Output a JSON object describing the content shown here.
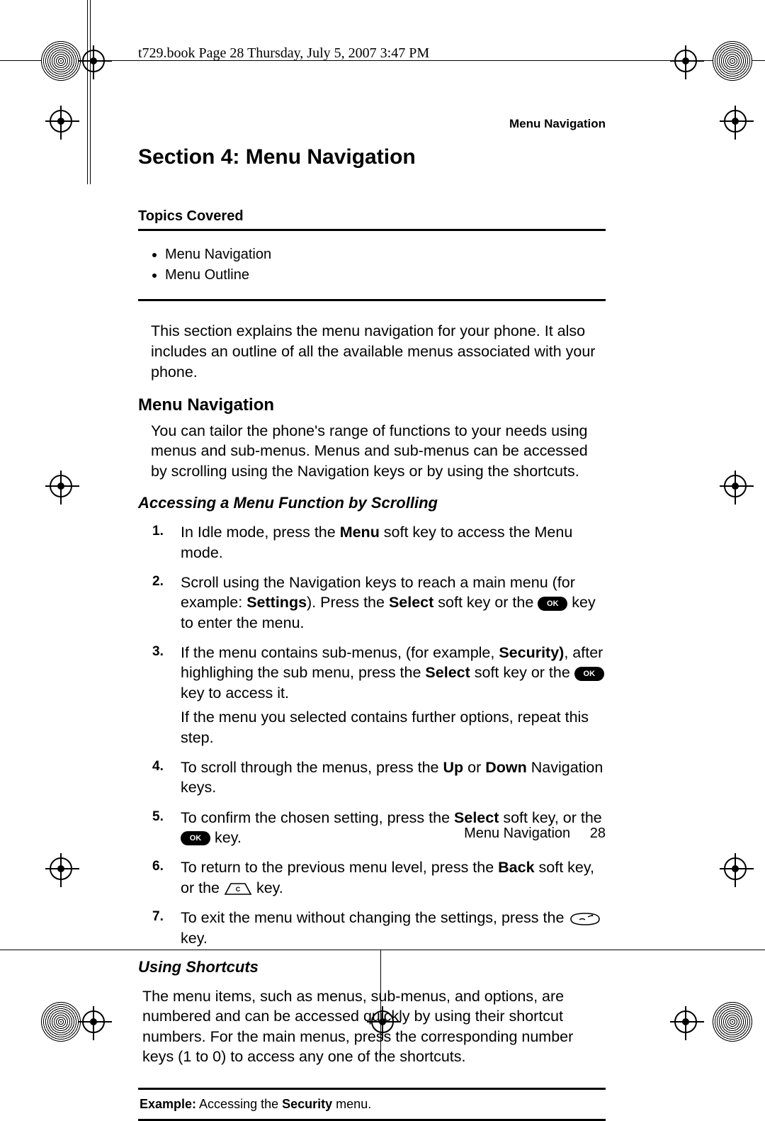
{
  "print_header": "t729.book  Page 28  Thursday, July 5, 2007  3:47 PM",
  "running_head": "Menu Navigation",
  "section_title": "Section 4: Menu Navigation",
  "topics_label": "Topics Covered",
  "topics": [
    "Menu Navigation",
    "Menu Outline"
  ],
  "intro": "This section explains the menu navigation for your phone. It also includes an outline of all the available menus associated with your phone.",
  "h2_menu_nav": "Menu Navigation",
  "menu_nav_para": "You can tailor the phone's range of functions to your needs using menus and sub-menus. Menus and sub-menus can be accessed by scrolling using the Navigation keys or by using the shortcuts.",
  "h3_scrolling": "Accessing a Menu Function by Scrolling",
  "steps": {
    "s1": {
      "pre": "In Idle mode, press the ",
      "b1": "Menu",
      "post": " soft key to access the Menu mode."
    },
    "s2": {
      "a": "Scroll using the Navigation keys to reach a main menu (for example: ",
      "b1": "Settings",
      "b1_after": "). Press the ",
      "b2": "Select",
      "mid": " soft key or the ",
      "ok": "OK",
      "post": " key to enter the menu."
    },
    "s3": {
      "a": "If the menu contains sub-menus, (for example, ",
      "b1": "Security)",
      "a2": ", after highlighing the sub menu, press the ",
      "b2": "Select",
      "mid": " soft key or the ",
      "ok": "OK",
      "post": " key to access it.",
      "line2": "If the menu you selected contains further options, repeat this step."
    },
    "s4": {
      "a": "To scroll through the menus, press the ",
      "b1": "Up",
      "mid": " or ",
      "b2": "Down",
      "post": " Navigation keys."
    },
    "s5": {
      "a": "To confirm the chosen setting, press the ",
      "b1": "Select",
      "mid": " soft key, or the ",
      "ok": "OK",
      "post": " key."
    },
    "s6": {
      "a": "To return to the previous menu level, press the ",
      "b1": "Back",
      "mid": " soft key, or the ",
      "post": " key."
    },
    "s7": {
      "a": "To exit the menu without changing the settings, press the ",
      "post": " key."
    }
  },
  "h3_shortcuts": "Using Shortcuts",
  "shortcuts_para": "The menu items, such as menus, sub-menus, and options, are numbered and can be accessed quickly by using their shortcut numbers. For the main menus, press the corresponding number keys (1 to 0) to access any one of the shortcuts.",
  "example_label": "Example:",
  "example_text_a": " Accessing the ",
  "example_bold": "Security",
  "example_text_b": " menu.",
  "footer_label": "Menu Navigation",
  "page_number": "28"
}
